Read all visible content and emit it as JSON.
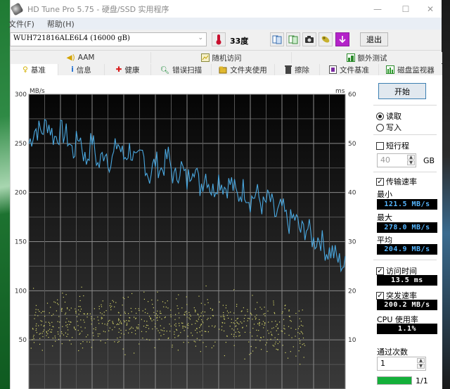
{
  "window": {
    "title": "HD Tune Pro 5.75 - 硬盘/SSD 实用程序",
    "controls": {
      "minimize": "—",
      "maximize": "☐",
      "close": "✕"
    }
  },
  "menu": {
    "items": [
      "文件(F)",
      "帮助(H)"
    ]
  },
  "toolbar": {
    "drive": "WUH721816ALE6L4 (16000 gB)",
    "temperature": "33度",
    "icons": [
      "copy-info-icon",
      "copy-results-icon",
      "screenshot-camera-icon",
      "options-icon",
      "save-download-icon"
    ],
    "exit_label": "退出"
  },
  "tabs": {
    "top_row": [
      {
        "label": "AAM",
        "icon": "speaker-icon"
      },
      {
        "label": "随机访问",
        "icon": "random-chart-icon"
      },
      {
        "label": "额外测试",
        "icon": "extra-test-icon"
      }
    ],
    "bottom_row": [
      {
        "label": "基准",
        "icon": "bulb-icon",
        "active": true
      },
      {
        "label": "信息",
        "icon": "info-icon"
      },
      {
        "label": "健康",
        "icon": "health-cross-icon"
      },
      {
        "label": "错误扫描",
        "icon": "magnifier-icon"
      },
      {
        "label": "文件夹使用",
        "icon": "folder-icon"
      },
      {
        "label": "擦除",
        "icon": "trash-icon"
      },
      {
        "label": "文件基准",
        "icon": "file-benchmark-icon"
      },
      {
        "label": "磁盘监视器",
        "icon": "disk-monitor-icon"
      }
    ]
  },
  "side": {
    "start_label": "开始",
    "mode_options": [
      {
        "label": "读取",
        "selected": true
      },
      {
        "label": "写入",
        "selected": false
      }
    ],
    "short_stroke": {
      "label": "短行程",
      "checked": false,
      "value": "40",
      "unit": "GB"
    },
    "transfer_rate": {
      "label": "传输速率",
      "checked": true
    },
    "min_label": "最小",
    "min_value": "121.5 MB/s",
    "max_label": "最大",
    "max_value": "278.0 MB/s",
    "avg_label": "平均",
    "avg_value": "204.9 MB/s",
    "access_time": {
      "label": "访问时间",
      "checked": true,
      "value": "13.5 ms"
    },
    "burst_rate": {
      "label": "突发速率",
      "checked": true,
      "value": "200.2 MB/s"
    },
    "cpu_label": "CPU 使用率",
    "cpu_value": "1.1%",
    "passes_label": "通过次数",
    "passes_value": "1",
    "progress_fraction": 1.0,
    "progress_text": "1/1"
  },
  "chart_data": {
    "type": "line",
    "title": "",
    "ylabel_left": "MB/s",
    "ylabel_right": "ms",
    "ylim_left": [
      0,
      300
    ],
    "ylim_right": [
      0,
      60
    ],
    "yticks_left": [
      50,
      100,
      150,
      200,
      250,
      300
    ],
    "yticks_right": [
      10,
      20,
      30,
      40,
      50,
      60
    ],
    "grid": true,
    "series": [
      {
        "name": "transfer rate",
        "axis": "left",
        "color": "#4aa8e0",
        "x_percent": [
          0,
          2,
          4,
          6,
          8,
          10,
          12,
          14,
          16,
          18,
          20,
          22,
          24,
          26,
          28,
          30,
          32,
          34,
          36,
          38,
          40,
          42,
          44,
          46,
          48,
          50,
          52,
          54,
          56,
          58,
          60,
          62,
          64,
          66,
          68,
          70,
          72,
          74,
          76,
          78,
          80,
          82,
          84,
          86,
          88,
          90,
          92,
          94,
          96,
          98,
          100
        ],
        "values": [
          250,
          265,
          262,
          272,
          255,
          262,
          258,
          240,
          260,
          230,
          255,
          225,
          245,
          228,
          252,
          235,
          245,
          228,
          240,
          215,
          232,
          222,
          238,
          212,
          228,
          210,
          232,
          205,
          220,
          200,
          215,
          205,
          210,
          195,
          205,
          192,
          200,
          185,
          195,
          175,
          185,
          168,
          175,
          160,
          165,
          150,
          155,
          140,
          140,
          130,
          125
        ]
      },
      {
        "name": "access time",
        "axis": "right",
        "type": "scatter",
        "color": "#d8d86a",
        "value_range_ms": [
          4,
          26
        ],
        "cluster_center_ms": 13.5
      }
    ]
  }
}
